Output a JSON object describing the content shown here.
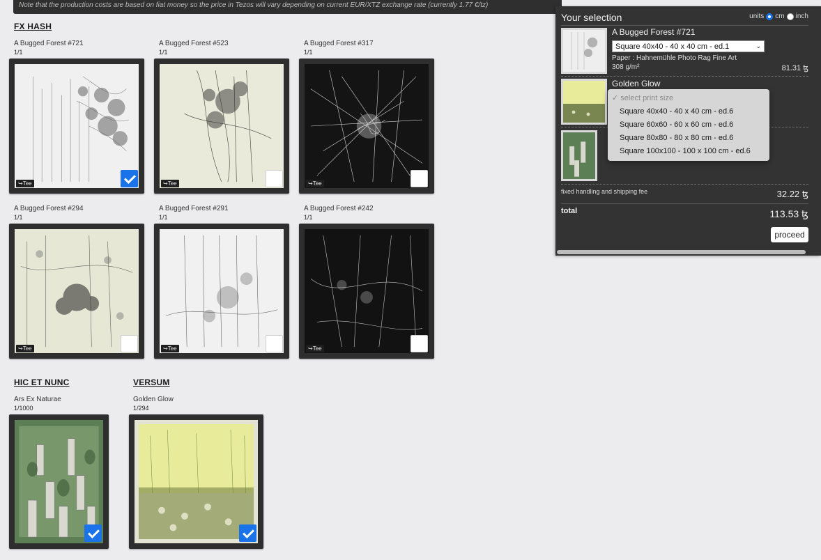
{
  "note": "Note that the production costs are based on fiat money so the price in Tezos will vary depending on current EUR/XTZ exchange rate (currently 1.77 €/tz)",
  "sections": {
    "fxhash": "FX HASH",
    "hen": "HIC ET NUNC",
    "versum": "VERSUM"
  },
  "fxhash_cards": [
    {
      "title": "A Bugged Forest #721",
      "edition": "1/1",
      "badge": "↪Tee",
      "checked": true
    },
    {
      "title": "A Bugged Forest #523",
      "edition": "1/1",
      "badge": "↪Tee",
      "checked": false
    },
    {
      "title": "A Bugged Forest #317",
      "edition": "1/1",
      "badge": "↪Tee",
      "checked": false
    },
    {
      "title": "A Bugged Forest #294",
      "edition": "1/1",
      "badge": "↪Tee",
      "checked": false
    },
    {
      "title": "A Bugged Forest #291",
      "edition": "1/1",
      "badge": "↪Tee",
      "checked": false
    },
    {
      "title": "A Bugged Forest #242",
      "edition": "1/1",
      "badge": "↪Tee",
      "checked": false
    }
  ],
  "hen_cards": [
    {
      "title": "Ars Ex Naturae",
      "edition": "1/1000",
      "checked": true
    }
  ],
  "versum_cards": [
    {
      "title": "Golden Glow",
      "edition": "1/294",
      "checked": true
    }
  ],
  "selection": {
    "header": "Your selection",
    "units_label": "units",
    "unit_cm": "cm",
    "unit_inch": "inch",
    "selected_unit": "cm",
    "items": [
      {
        "title": "A Bugged Forest #721",
        "size_selected": "Square 40x40 - 40 x 40 cm - ed.1",
        "paper_line1": "Paper : Hahnemühle Photo Rag Fine Art",
        "paper_line2": "308 g/m²",
        "price": "81.31 ꜩ"
      },
      {
        "title": "Golden Glow"
      },
      {
        "title": ""
      }
    ],
    "dropdown_options": [
      "✓ select print size",
      "Square 40x40 - 40 x 40 cm - ed.6",
      "Square 60x60 - 60 x 60 cm - ed.6",
      "Square 80x80 - 80 x 80 cm - ed.6",
      "Square 100x100 - 100 x 100 cm - ed.6"
    ],
    "fee_label": "fixed handling and shipping fee",
    "fee_value": "32.22 ꜩ",
    "total_label": "total",
    "total_value": "113.53 ꜩ",
    "proceed_label": "proceed"
  },
  "colors": {
    "background": "#ececef",
    "frame": "#2e2e2e",
    "panel": "#333333",
    "accent": "#1a73e8"
  }
}
